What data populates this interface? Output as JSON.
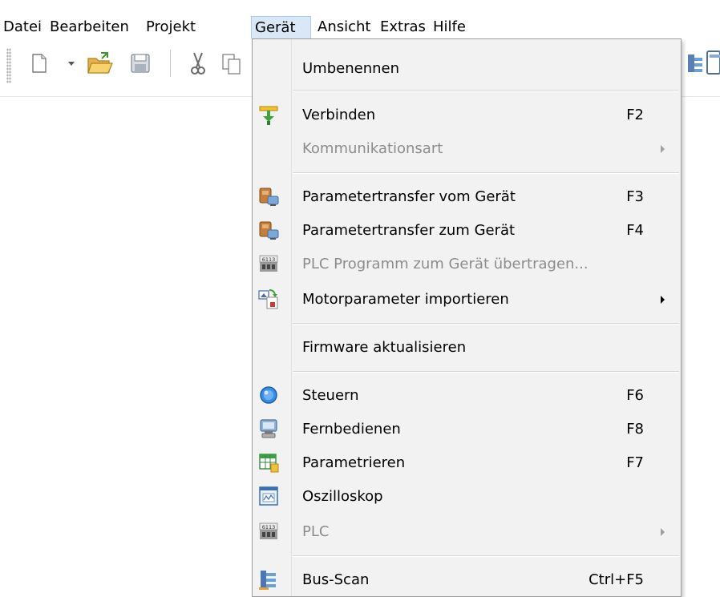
{
  "menubar": {
    "items": [
      {
        "label": "Datei"
      },
      {
        "label": "Bearbeiten"
      },
      {
        "label": "Projekt"
      },
      {
        "label": "Gerät"
      },
      {
        "label": "Ansicht"
      },
      {
        "label": "Extras"
      },
      {
        "label": "Hilfe"
      }
    ],
    "active": "Gerät"
  },
  "toolbar": {
    "icons": [
      "new-document-icon",
      "dropdown-arrow-icon",
      "open-folder-icon",
      "save-icon",
      "cut-icon",
      "copy-icon",
      "bus-scan-icon",
      "window-icon"
    ]
  },
  "menu": {
    "items": [
      {
        "label": "Umbenennen",
        "shortcut": "",
        "icon": "none",
        "disabled": false
      },
      {
        "label": "Verbinden",
        "shortcut": "F2",
        "icon": "connect-icon",
        "disabled": false
      },
      {
        "label": "Kommunikationsart",
        "shortcut": "",
        "icon": "none",
        "disabled": true,
        "submenu": true
      },
      {
        "label": "Parametertransfer vom Gerät",
        "shortcut": "F3",
        "icon": "transfer-from-device-icon",
        "disabled": false
      },
      {
        "label": "Parametertransfer zum Gerät",
        "shortcut": "F4",
        "icon": "transfer-to-device-icon",
        "disabled": false
      },
      {
        "label": "PLC Programm zum Gerät übertragen...",
        "shortcut": "",
        "icon": "plc-icon",
        "disabled": true
      },
      {
        "label": "Motorparameter importieren",
        "shortcut": "",
        "icon": "import-motor-icon",
        "disabled": false,
        "submenu": true
      },
      {
        "label": "Firmware aktualisieren",
        "shortcut": "",
        "icon": "none",
        "disabled": false
      },
      {
        "label": "Steuern",
        "shortcut": "F6",
        "icon": "control-icon",
        "disabled": false
      },
      {
        "label": "Fernbedienen",
        "shortcut": "F8",
        "icon": "remote-control-icon",
        "disabled": false
      },
      {
        "label": "Parametrieren",
        "shortcut": "F7",
        "icon": "parametrize-icon",
        "disabled": false
      },
      {
        "label": "Oszilloskop",
        "shortcut": "",
        "icon": "oscilloscope-icon",
        "disabled": false
      },
      {
        "label": "PLC",
        "shortcut": "",
        "icon": "plc-icon",
        "disabled": true,
        "submenu": true
      },
      {
        "label": "Bus-Scan",
        "shortcut": "Ctrl+F5",
        "icon": "bus-scan-icon",
        "disabled": false
      }
    ],
    "plc_badge": "6113"
  }
}
